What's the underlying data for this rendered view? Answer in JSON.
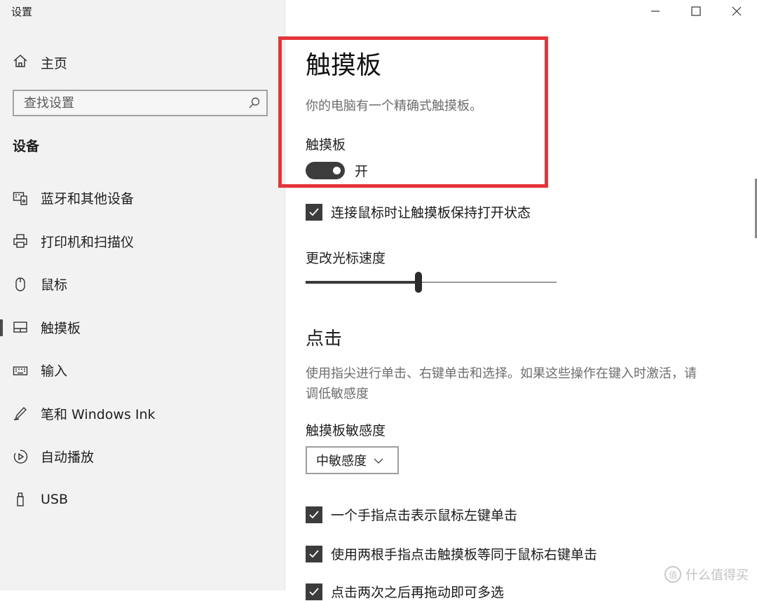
{
  "app": {
    "title": "设置"
  },
  "sidebar": {
    "home_label": "主页",
    "search_placeholder": "查找设置",
    "section_title": "设备",
    "items": [
      {
        "label": "蓝牙和其他设备",
        "icon": "bluetooth-devices-icon"
      },
      {
        "label": "打印机和扫描仪",
        "icon": "printer-icon"
      },
      {
        "label": "鼠标",
        "icon": "mouse-icon"
      },
      {
        "label": "触摸板",
        "icon": "touchpad-icon",
        "active": true
      },
      {
        "label": "输入",
        "icon": "keyboard-icon"
      },
      {
        "label": "笔和 Windows Ink",
        "icon": "pen-icon"
      },
      {
        "label": "自动播放",
        "icon": "autoplay-icon"
      },
      {
        "label": "USB",
        "icon": "usb-icon"
      }
    ]
  },
  "window_controls": [
    "minimize-icon",
    "maximize-icon",
    "close-icon"
  ],
  "main": {
    "title": "触摸板",
    "description": "你的电脑有一个精确式触摸板。",
    "toggle": {
      "label": "触摸板",
      "state_text": "开",
      "on": true
    },
    "keep_on_checkbox": {
      "label": "连接鼠标时让触摸板保持打开状态",
      "checked": true
    },
    "cursor_speed": {
      "label": "更改光标速度",
      "value_fraction": 0.45
    },
    "taps": {
      "title": "点击",
      "description": "使用指尖进行单击、右键单击和选择。如果这些操作在键入时激活，请调低敏感度",
      "sensitivity_label": "触摸板敏感度",
      "sensitivity_value": "中敏感度",
      "checkboxes": [
        {
          "label": "一个手指点击表示鼠标左键单击",
          "checked": true
        },
        {
          "label": "使用两根手指点击触摸板等同于鼠标右键单击",
          "checked": true
        },
        {
          "label": "点击两次之后再拖动即可多选",
          "checked": true
        }
      ]
    }
  },
  "colors": {
    "highlight_border": "#e5343a",
    "control_dark": "#3c3c3c"
  },
  "watermark": "什么值得买"
}
